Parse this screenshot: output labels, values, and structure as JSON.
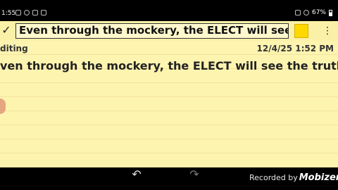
{
  "status_bar": {
    "time": "1:55",
    "battery": "67%"
  },
  "toolbar": {
    "title_value": "Even through the mockery, the ELECT will see th",
    "swatch_color": "#ffd800"
  },
  "note": {
    "mode_label": "diting",
    "timestamp": "12/4/25 1:52 PM",
    "body": "ven through the mockery, the ELECT will see the truth."
  },
  "bottom": {
    "recorded_by": "Recorded by",
    "brand": "Mobizen"
  },
  "icons": [
    "check-icon",
    "more-vert-icon",
    "undo-icon",
    "redo-icon"
  ]
}
